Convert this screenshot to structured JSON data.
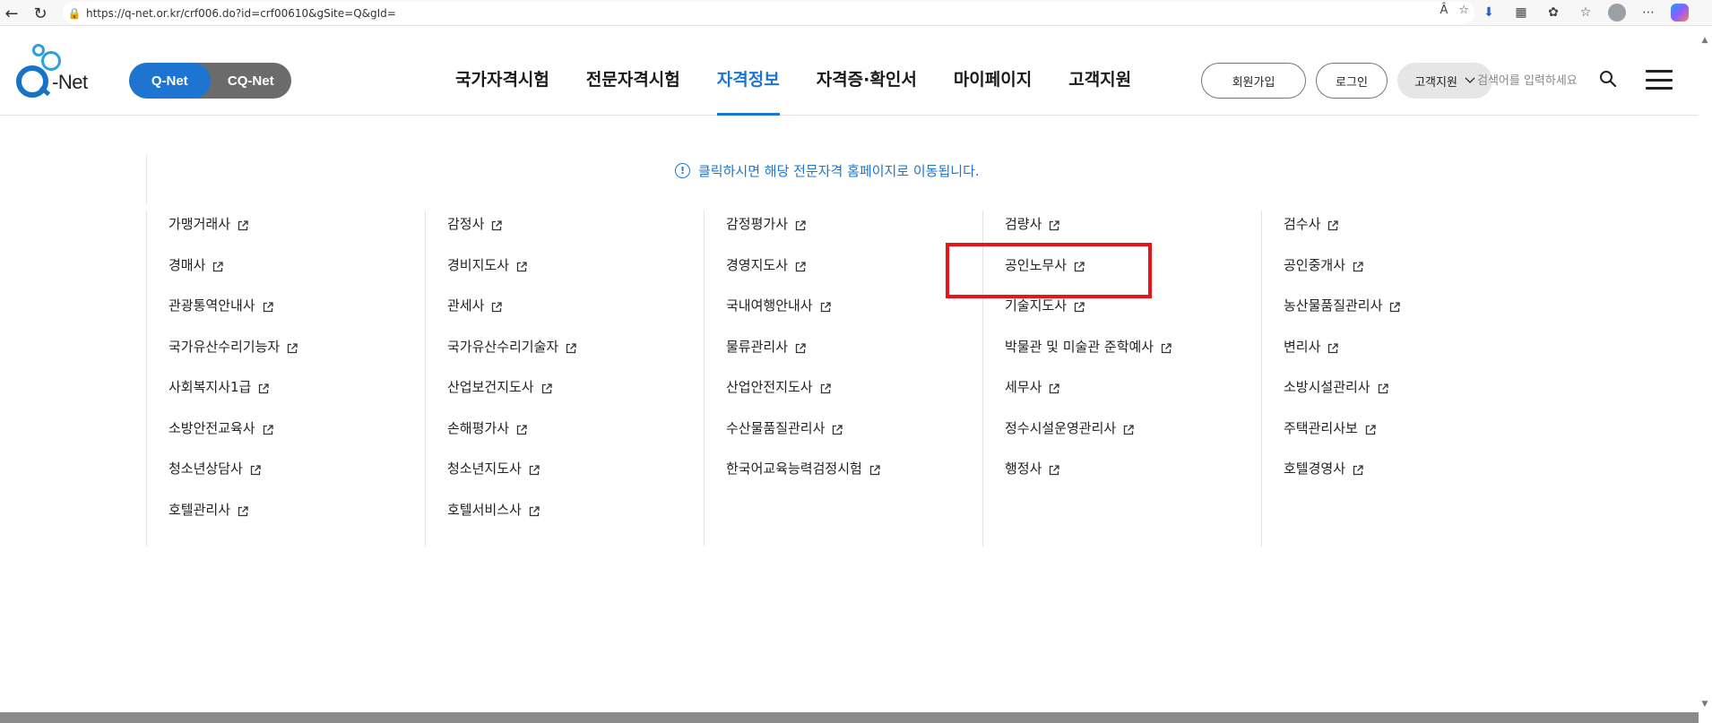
{
  "browser": {
    "url": "https://q-net.or.kr/crf006.do?id=crf00610&gSite=Q&gId="
  },
  "header": {
    "logo_text": "Q-Net",
    "site_switch": [
      "Q-Net",
      "CQ-Net"
    ],
    "gnb": [
      "국가자격시험",
      "전문자격시험",
      "자격정보",
      "자격증·확인서",
      "마이페이지",
      "고객지원"
    ],
    "active_gnb": "자격정보",
    "util": {
      "signup": "회원가입",
      "login": "로그인",
      "support": "고객지원"
    },
    "search_placeholder": "검색어를 입력하세요"
  },
  "notice": "클릭하시면 해당 전문자격 홈페이지로 이동됩니다.",
  "columns": [
    [
      "가맹거래사",
      "경매사",
      "관광통역안내사",
      "국가유산수리기능자",
      "사회복지사1급",
      "소방안전교육사",
      "청소년상담사",
      "호텔관리사"
    ],
    [
      "감정사",
      "경비지도사",
      "관세사",
      "국가유산수리기술자",
      "산업보건지도사",
      "손해평가사",
      "청소년지도사",
      "호텔서비스사"
    ],
    [
      "감정평가사",
      "경영지도사",
      "국내여행안내사",
      "물류관리사",
      "산업안전지도사",
      "수산물품질관리사",
      "한국어교육능력검정시험"
    ],
    [
      "검량사",
      "공인노무사",
      "기술지도사",
      "박물관 및 미술관 준학예사",
      "세무사",
      "정수시설운영관리사",
      "행정사"
    ],
    [
      "검수사",
      "공인중개사",
      "농산물품질관리사",
      "변리사",
      "소방시설관리사",
      "주택관리사보",
      "호텔경영사"
    ]
  ],
  "highlighted_item": "공인노무사",
  "colors": {
    "brand_blue": "#1d74d1",
    "highlight_red": "#e8141a"
  }
}
